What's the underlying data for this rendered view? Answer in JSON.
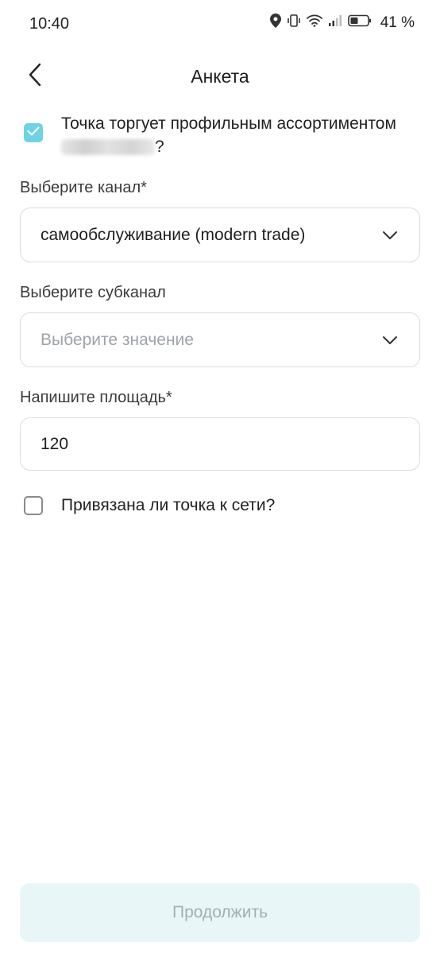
{
  "status_bar": {
    "time": "10:40",
    "battery_percent": "41 %",
    "icons": [
      "location-icon",
      "vibrate-icon",
      "wifi-icon",
      "signal-icon",
      "battery-icon"
    ]
  },
  "header": {
    "title": "Анкета",
    "back_icon": "chevron-left-icon"
  },
  "questionnaire": {
    "profile_assortment": {
      "label_line1": "Точка торгует профильным ассортиментом",
      "label_suffix": "?",
      "checked": true
    },
    "channel": {
      "label": "Выберите канал*",
      "value": "самообслуживание (modern trade)"
    },
    "subchannel": {
      "label": "Выберите субканал",
      "placeholder": "Выберите значение"
    },
    "area": {
      "label": "Напишите площадь*",
      "value": "120"
    },
    "chain_linked": {
      "label": "Привязана ли точка к сети?",
      "checked": false
    }
  },
  "footer": {
    "continue_label": "Продолжить"
  },
  "colors": {
    "accent": "#6dd3e3",
    "button_bg_disabled": "#e8f6f8",
    "button_text_disabled": "#a3b0b3",
    "placeholder": "#9ea3a8",
    "border": "#d9dcdf"
  }
}
